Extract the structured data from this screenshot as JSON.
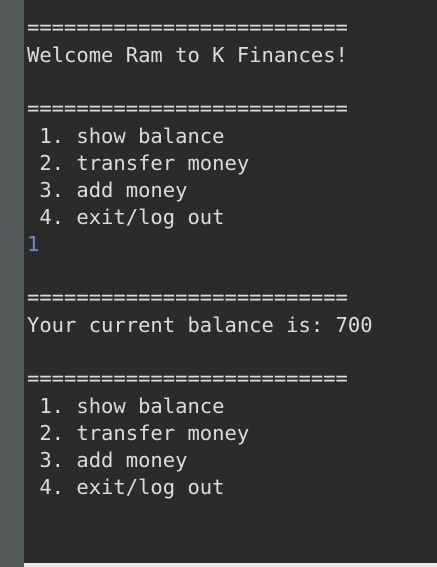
{
  "console": {
    "lines": [
      "==========================",
      "Welcome Ram to K Finances!",
      "",
      "==========================",
      " 1. show balance",
      " 2. transfer money",
      " 3. add money",
      " 4. exit/log out",
      "1",
      "",
      "==========================",
      "Your current balance is: 700",
      "",
      "==========================",
      " 1. show balance",
      " 2. transfer money",
      " 3. add money",
      " 4. exit/log out"
    ]
  },
  "colors": {
    "background": "#2b2b2b",
    "gutter": "#535858",
    "text": "#dcdcdc",
    "user_input": "#6f8fbf"
  }
}
